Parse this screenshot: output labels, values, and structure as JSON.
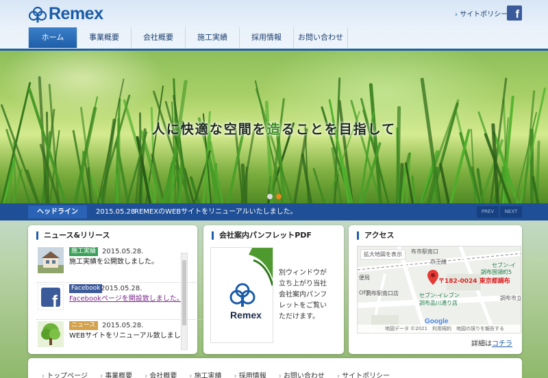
{
  "brand": {
    "logo_text": "Remex"
  },
  "header": {
    "policy_link": "サイトポリシー",
    "facebook_icon": "facebook-icon",
    "facebook_glyph": "f"
  },
  "nav": {
    "items": [
      {
        "label": "ホーム",
        "active": true
      },
      {
        "label": "事業概要"
      },
      {
        "label": "会社概要"
      },
      {
        "label": "施工実績"
      },
      {
        "label": "採用情報"
      },
      {
        "label": "お問い合わせ"
      }
    ]
  },
  "hero": {
    "copy_before": "人に快適な空間を",
    "copy_accent": "造",
    "copy_after": "ることを目指して",
    "slide_dots": 2,
    "active_slide": 2
  },
  "headline": {
    "label": "ヘッドライン",
    "date": "2015.05.28",
    "text": "REMEXのWEBサイトをリニューアルいたしました。",
    "prev": "PREV",
    "next": "NEXT"
  },
  "news": {
    "title": "ニュース&リリース",
    "items": [
      {
        "tag": "施工実績",
        "tag_color": "#3aa05a",
        "date": "2015.05.28.",
        "text": "施工実績を公開致しました。",
        "link": false
      },
      {
        "tag": "Facebook",
        "tag_color": "#3b5a9a",
        "date": "2015.05.28.",
        "text": "Facebookページを開設致しました。",
        "link": true
      },
      {
        "tag": "ニュース",
        "tag_color": "#d4a24a",
        "date": "2015.05.28.",
        "text": "WEBサイトをリニューアル致しまし",
        "link": false
      }
    ]
  },
  "pamphlet": {
    "title": "会社案内パンフレットPDF",
    "cover_logo": "Remex",
    "text": "別ウィンドウが立ち上がり当社会社案内パンフレットをご覧いただけます。"
  },
  "access": {
    "title": "アクセス",
    "enlarge_button": "拡大地図を表示",
    "address_label": "〒182-0024 東京都調布",
    "map_labels": [
      "布市駅南口",
      "京王線",
      "セブン-イ",
      "調布国領町5",
      "調布駅南口店",
      "セブン-イレブン",
      "調布品川通り店",
      "調布市立",
      "便局",
      "OFF"
    ],
    "google": "Google",
    "map_footer": "地図データ ©2021　利用規約　地図の誤りを報告する",
    "detail_prefix": "詳細は",
    "detail_link": "コチラ"
  },
  "footer": {
    "links": [
      "トップページ",
      "事業概要",
      "会社概要",
      "施工実績",
      "採用情報",
      "お問い合わせ",
      "サイトポリシー"
    ]
  }
}
